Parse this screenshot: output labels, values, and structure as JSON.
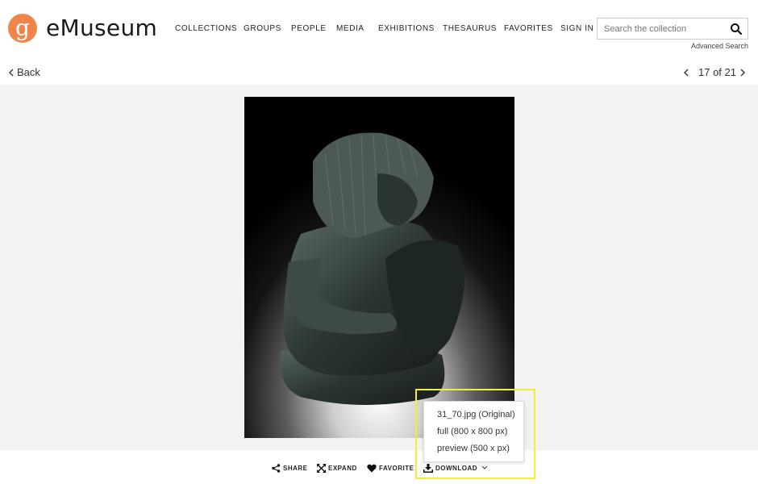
{
  "brand": {
    "name": "eMuseum",
    "logo_letter": "g",
    "logo_color": "#f0844a"
  },
  "nav": {
    "items": [
      {
        "id": "collections",
        "label": "COLLECTIONS"
      },
      {
        "id": "groups",
        "label": "GROUPS"
      },
      {
        "id": "people",
        "label": "PEOPLE"
      },
      {
        "id": "media",
        "label": "MEDIA"
      },
      {
        "id": "exhibitions",
        "label": "EXHIBITIONS"
      },
      {
        "id": "thesaurus",
        "label": "THESAURUS"
      },
      {
        "id": "favorites",
        "label": "FAVORITES"
      },
      {
        "id": "signin",
        "label": "SIGN IN"
      }
    ]
  },
  "search": {
    "placeholder": "Search the collection",
    "value": "",
    "advanced_label": "Advanced Search"
  },
  "back": {
    "label": "Back"
  },
  "pager": {
    "current": 17,
    "total": 21,
    "label": "17 of 21"
  },
  "artwork": {
    "alt": "Sculpture"
  },
  "toolbar": {
    "share_label": "SHARE",
    "expand_label": "EXPAND",
    "favorite_label": "FAVORITE",
    "download_label": "DOWNLOAD"
  },
  "download_menu": {
    "items": [
      {
        "label": "31_70.jpg (Original)"
      },
      {
        "label": "full (800 x 800 px)"
      },
      {
        "label": "preview (500 x px)"
      }
    ]
  },
  "colors": {
    "highlight": "#f4ee3a",
    "viewer_bg": "#f2f2f2"
  }
}
